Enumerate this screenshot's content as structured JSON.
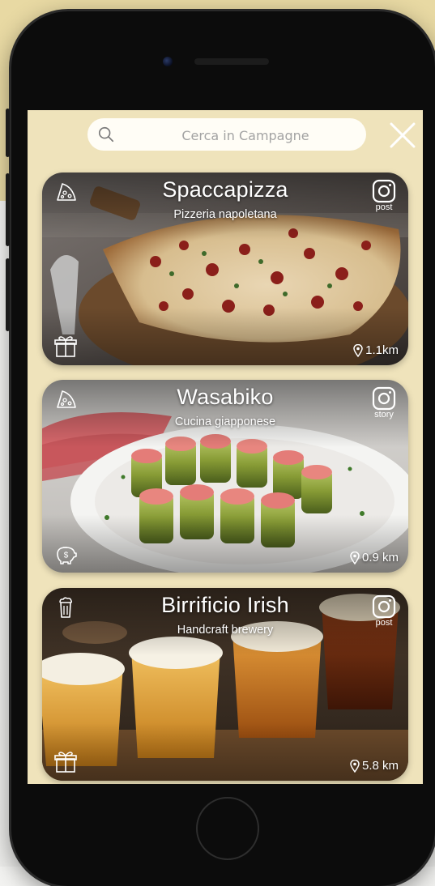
{
  "search": {
    "placeholder": "Cerca in Campagne",
    "icon": "search-icon",
    "close_icon": "close-icon"
  },
  "colors": {
    "background_band": "#e8d9a3",
    "screen_bg": "#efe3bb",
    "search_bg": "#fffdf6"
  },
  "cards": [
    {
      "title": "Spaccapizza",
      "subtitle": "Pizzeria napoletana",
      "category_icon": "pizza-slice-icon",
      "social_icon": "instagram-icon",
      "social_label": "post",
      "perk_icon": "gift-icon",
      "distance": "1.1km"
    },
    {
      "title": "Wasabiko",
      "subtitle": "Cucina giapponese",
      "category_icon": "pizza-slice-icon",
      "social_icon": "instagram-icon",
      "social_label": "story",
      "perk_icon": "piggy-bank-icon",
      "distance": "0.9 km"
    },
    {
      "title": "Birrificio Irish",
      "subtitle": "Handcraft brewery",
      "category_icon": "beer-mug-icon",
      "social_icon": "instagram-icon",
      "social_label": "post",
      "perk_icon": "gift-icon",
      "distance": "5.8 km"
    }
  ]
}
